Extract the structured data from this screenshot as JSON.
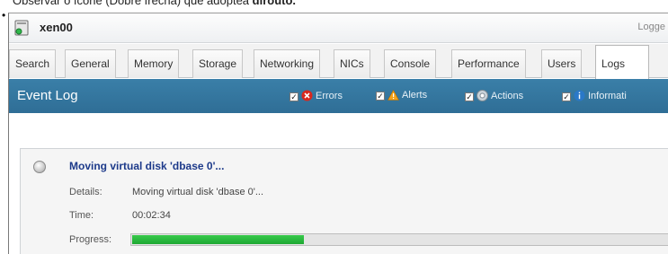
{
  "caption": {
    "text_before": "Observar o ícone (Dobre frecha) que adoptea ",
    "text_bold": "dirouto."
  },
  "window": {
    "title": "xen00",
    "logged_text": "Logge"
  },
  "tabs": [
    {
      "label": "Search",
      "active": false
    },
    {
      "label": "General",
      "active": false
    },
    {
      "label": "Memory",
      "active": false
    },
    {
      "label": "Storage",
      "active": false
    },
    {
      "label": "Networking",
      "active": false
    },
    {
      "label": "NICs",
      "active": false
    },
    {
      "label": "Console",
      "active": false
    },
    {
      "label": "Performance",
      "active": false
    },
    {
      "label": "Users",
      "active": false
    },
    {
      "label": "Logs",
      "active": true
    }
  ],
  "event_log": {
    "title": "Event Log",
    "filters": {
      "errors": "Errors",
      "alerts": "Alerts",
      "actions": "Actions",
      "information": "Informati"
    }
  },
  "event": {
    "name": "Moving virtual disk 'dbase 0'...",
    "details_label": "Details:",
    "details_value": "Moving virtual disk 'dbase 0'...",
    "time_label": "Time:",
    "time_value": "00:02:34",
    "progress_label": "Progress:",
    "progress_fraction": 0.32
  },
  "colors": {
    "header_blue": "#3a7fa8",
    "progress_green": "#24b838",
    "event_title_blue": "#1d3a8a"
  }
}
